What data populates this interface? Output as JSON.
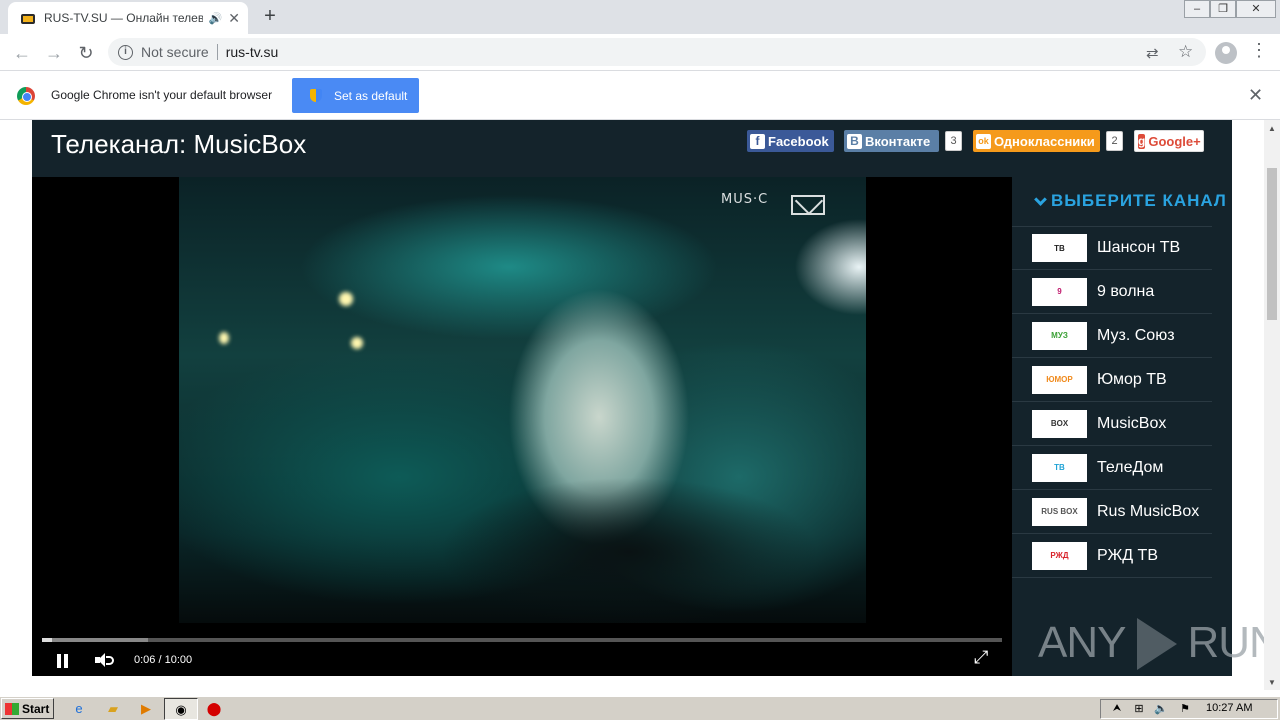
{
  "browser": {
    "tab_title": "RUS-TV.SU — Онлайн телевид",
    "new_tab": "+",
    "tab_close": "✕",
    "security_label": "Not secure",
    "url": "rus-tv.su"
  },
  "infobar": {
    "message": "Google Chrome isn't your default browser",
    "button": "Set as default",
    "close": "✕"
  },
  "page": {
    "title": "Телеканал: MusicBox",
    "share": [
      {
        "label": "Facebook",
        "icon": "f",
        "color": "#3b5998"
      },
      {
        "label": "Вконтакте",
        "icon": "B",
        "color": "#5b7fa6"
      },
      {
        "label": "Одноклассники",
        "icon": "ok",
        "color": "#f59a1b"
      },
      {
        "label": "Google+",
        "icon": "g",
        "color": "#dd4b39"
      }
    ],
    "vk_count": "3",
    "ok_count": "2"
  },
  "player": {
    "watermark": "MUS·C",
    "time": "0:06 / 10:00",
    "progress_fraction": 0.01,
    "buffered_fraction": 0.11
  },
  "sidebar": {
    "title": "ВЫБЕРИТЕ КАНАЛ",
    "channels": [
      {
        "name": "Шансон ТВ",
        "logo": "ТВ",
        "logo_color": "#222"
      },
      {
        "name": "9 волна",
        "logo": "9",
        "logo_color": "#c0186c"
      },
      {
        "name": "Муз. Союз",
        "logo": "МУЗ",
        "logo_color": "#3aa035"
      },
      {
        "name": "Юмор ТВ",
        "logo": "ЮМОР",
        "logo_color": "#f08a1c"
      },
      {
        "name": "MusicBox",
        "logo": "BOX",
        "logo_color": "#333"
      },
      {
        "name": "ТелеДом",
        "logo": "ТВ",
        "logo_color": "#1fa3d6"
      },
      {
        "name": "Rus MusicBox",
        "logo": "RUS BOX",
        "logo_color": "#555"
      },
      {
        "name": "РЖД ТВ",
        "logo": "РЖД",
        "logo_color": "#d8232a"
      }
    ]
  },
  "watermark": {
    "any": "ANY",
    "run": "RUN"
  },
  "taskbar": {
    "start": "Start",
    "clock": "10:27 AM"
  }
}
